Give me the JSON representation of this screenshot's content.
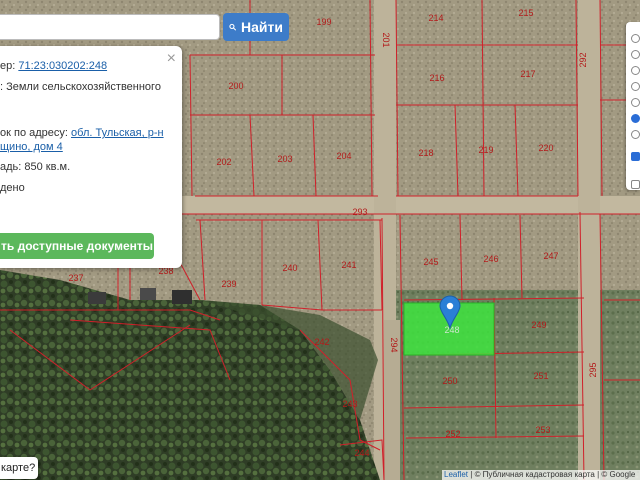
{
  "search": {
    "value": "",
    "placeholder": "",
    "button_label": "Найти"
  },
  "popup": {
    "cadastre_label": "ер:",
    "cadastre_number": "71:23:030202:248",
    "category_text": ": Земли сельскохозяйственного",
    "address_label": "ок по адресу:",
    "address_link_1": "обл. Тульская, р-н",
    "address_link_2": "щино, дом 4",
    "area_text": "адь: 850 кв.м.",
    "status_text": "дено",
    "docs_button": "ть доступные документы",
    "close": "×"
  },
  "parcels": {
    "selected": "248",
    "labels": [
      "199",
      "214",
      "215",
      "200",
      "216",
      "217",
      "202",
      "203",
      "204",
      "218",
      "219",
      "220",
      "237",
      "238",
      "239",
      "240",
      "241",
      "245",
      "246",
      "247",
      "242",
      "249",
      "250",
      "251",
      "243",
      "252",
      "253",
      "244"
    ],
    "road_labels": [
      "201",
      "293",
      "292",
      "294",
      "295"
    ]
  },
  "layers_panel": {
    "radio_checked_index": 5,
    "checkbox_checked_index": 0
  },
  "report_button": "карте?",
  "attribution": {
    "leaflet": "Leaflet",
    "separator": " | ",
    "source": "© Публичная кадастровая карта | © Google"
  },
  "colors": {
    "boundary": "#d0202a",
    "selected_fill": "#3ee43e",
    "marker": "#2a7fd6",
    "label": "#b31a1a",
    "search_button": "#3d7cc9",
    "docs_button": "#5cb85c"
  },
  "icons": {
    "search": "search-icon",
    "marker": "map-pin-icon",
    "close": "close-icon"
  }
}
